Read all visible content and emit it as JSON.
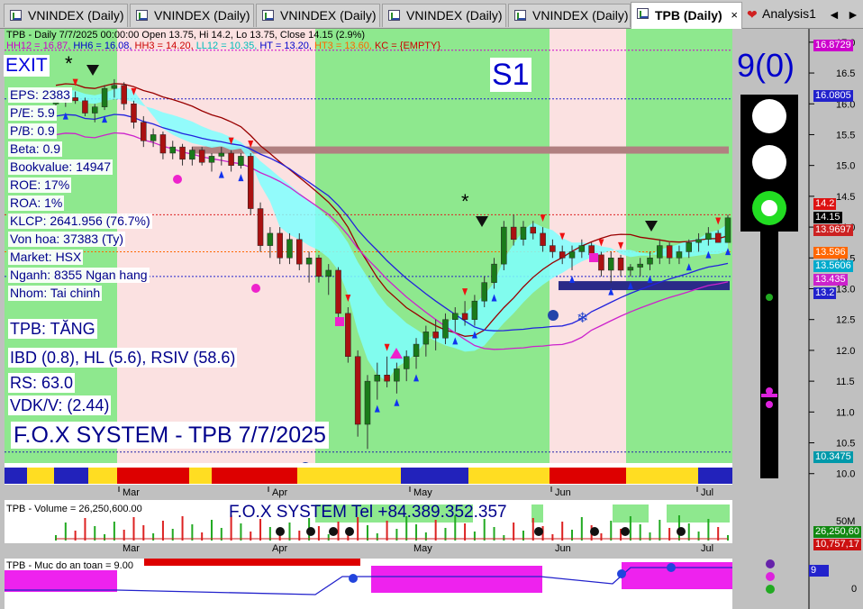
{
  "tabs": [
    {
      "label": "VNINDEX (Daily)",
      "active": false
    },
    {
      "label": "VNINDEX (Daily)",
      "active": false
    },
    {
      "label": "VNINDEX (Daily)",
      "active": false
    },
    {
      "label": "VNINDEX (Daily)",
      "active": false
    },
    {
      "label": "VNINDEX (Daily)",
      "active": false
    },
    {
      "label": "TPB (Daily)",
      "active": true,
      "close": "×"
    },
    {
      "label": "Analysis1",
      "active": false
    }
  ],
  "nav": {
    "left": "◄",
    "right": "►"
  },
  "header": {
    "line1": "TPB - Daily 7/7/2025 00:00:00 Open 13.75, Hi 14.2, Lo 13.75, Close 14.15 (2.9%)",
    "line2": [
      {
        "text": "HH12 = 16.87,",
        "color": "#cc00cc"
      },
      {
        "text": "HH6 = 16.08,",
        "color": "#0000cc"
      },
      {
        "text": "HH3 = 14.20,",
        "color": "#cc0000"
      },
      {
        "text": "LL12 = 10.35,",
        "color": "#00cccc"
      },
      {
        "text": "HT = 13.20,",
        "color": "#0000cc"
      },
      {
        "text": "HT3 = 13.60,",
        "color": "#ff6600"
      },
      {
        "text": "KC = {EMPTY}",
        "color": "#cc0000"
      }
    ]
  },
  "signals": {
    "exit": "EXIT",
    "s1": "S1",
    "nine_zero": "9(0)"
  },
  "fundamentals": [
    "EPS: 2383",
    "P/E: 5.9",
    "P/B: 0.9",
    "Beta: 0.9",
    "Bookvalue: 14947",
    "ROE: 17%",
    "ROA: 1%",
    "KLCP: 2641.956 (76.7%)",
    "Von hoa: 37383 (Ty)",
    "Market: HSX",
    "Nganh: 8355 Ngan hang",
    "Nhom: Tai chinh"
  ],
  "analysis": [
    "TPB: TĂNG",
    "IBD (0.8), HL (5.6), RSIV (58.6)",
    "RS: 63.0",
    "VDK/V:  (2.44)"
  ],
  "fox_title": "F.O.X SYSTEM - TPB 7/7/2025",
  "volume": {
    "title": "TPB - Volume = 26,250,600.00",
    "brand": "F.O.X SYSTEM Tel +84.389.352.357",
    "scale": "50M",
    "last": "26,250,60",
    "ma": "10,757,17"
  },
  "safety": {
    "title": "TPB - Muc do an toan = 9.00",
    "value_tag": "9",
    "zero": "0"
  },
  "months": [
    "Mar",
    "Apr",
    "May",
    "Jun",
    "Jul"
  ],
  "y_ticks": [
    "17.0",
    "16.5",
    "16.0",
    "15.5",
    "15.0",
    "14.5",
    "14.0",
    "13.5",
    "13.0",
    "12.5",
    "12.0",
    "11.5",
    "11.0",
    "10.5",
    "10.0"
  ],
  "price_tags": [
    {
      "text": "16.8729",
      "color": "#cc00cc"
    },
    {
      "text": "16.0805",
      "color": "#2222cc"
    },
    {
      "text": "14.2",
      "color": "#dd1111"
    },
    {
      "text": "14.15",
      "color": "#000000"
    },
    {
      "text": "13.9697",
      "color": "#cc2222"
    },
    {
      "text": "13.596",
      "color": "#ff6600"
    },
    {
      "text": "13.5606",
      "color": "#00aacc"
    },
    {
      "text": "13.435",
      "color": "#cc22cc"
    },
    {
      "text": "13.2",
      "color": "#2222cc"
    },
    {
      "text": "10.3475",
      "color": "#0099aa"
    }
  ],
  "chart_data": {
    "type": "candlestick",
    "ylim": [
      9.85,
      17.1
    ],
    "candles": [
      [
        16.0,
        16.1,
        15.9,
        16.05
      ],
      [
        16.05,
        16.15,
        15.95,
        16.1
      ],
      [
        16.1,
        16.2,
        16.0,
        16.05
      ],
      [
        16.05,
        16.1,
        15.8,
        15.85
      ],
      [
        15.85,
        16.0,
        15.7,
        15.95
      ],
      [
        15.95,
        16.3,
        15.9,
        16.25
      ],
      [
        16.25,
        16.4,
        16.1,
        16.3
      ],
      [
        16.3,
        16.35,
        15.9,
        16.0
      ],
      [
        16.0,
        16.05,
        15.6,
        15.7
      ],
      [
        15.7,
        15.8,
        15.3,
        15.4
      ],
      [
        15.4,
        15.6,
        15.3,
        15.5
      ],
      [
        15.5,
        15.55,
        15.1,
        15.2
      ],
      [
        15.2,
        15.4,
        15.1,
        15.3
      ],
      [
        15.3,
        15.35,
        15.0,
        15.1
      ],
      [
        15.1,
        15.3,
        15.0,
        15.25
      ],
      [
        15.25,
        15.3,
        15.0,
        15.05
      ],
      [
        15.05,
        15.2,
        14.9,
        15.15
      ],
      [
        15.15,
        15.3,
        15.0,
        15.2
      ],
      [
        15.2,
        15.25,
        14.9,
        15.0
      ],
      [
        15.0,
        15.2,
        14.95,
        15.15
      ],
      [
        15.15,
        15.2,
        14.2,
        14.3
      ],
      [
        14.3,
        14.4,
        13.6,
        13.7
      ],
      [
        13.7,
        14.0,
        13.5,
        13.9
      ],
      [
        13.9,
        14.0,
        13.4,
        13.5
      ],
      [
        13.5,
        13.9,
        13.4,
        13.8
      ],
      [
        13.8,
        13.9,
        13.3,
        13.4
      ],
      [
        13.4,
        13.6,
        13.1,
        13.5
      ],
      [
        13.5,
        13.55,
        13.1,
        13.2
      ],
      [
        13.2,
        13.4,
        12.9,
        13.3
      ],
      [
        13.3,
        13.35,
        12.5,
        12.6
      ],
      [
        12.6,
        12.7,
        11.8,
        11.9
      ],
      [
        11.9,
        12.0,
        10.6,
        10.8
      ],
      [
        10.8,
        11.6,
        10.4,
        11.5
      ],
      [
        11.5,
        11.8,
        11.2,
        11.6
      ],
      [
        11.6,
        11.9,
        11.4,
        11.5
      ],
      [
        11.5,
        11.8,
        11.3,
        11.7
      ],
      [
        11.7,
        12.0,
        11.5,
        11.9
      ],
      [
        11.9,
        12.2,
        11.7,
        12.1
      ],
      [
        12.1,
        12.4,
        11.9,
        12.3
      ],
      [
        12.3,
        12.5,
        12.0,
        12.2
      ],
      [
        12.2,
        12.6,
        12.1,
        12.5
      ],
      [
        12.5,
        12.7,
        12.3,
        12.6
      ],
      [
        12.6,
        12.8,
        12.4,
        12.5
      ],
      [
        12.5,
        12.9,
        12.4,
        12.8
      ],
      [
        12.8,
        13.2,
        12.7,
        13.1
      ],
      [
        13.1,
        13.5,
        13.0,
        13.4
      ],
      [
        13.4,
        14.1,
        13.3,
        14.0
      ],
      [
        14.0,
        14.2,
        13.7,
        13.8
      ],
      [
        13.8,
        14.1,
        13.7,
        14.0
      ],
      [
        14.0,
        14.1,
        13.8,
        13.9
      ],
      [
        13.9,
        14.0,
        13.6,
        13.7
      ],
      [
        13.7,
        13.8,
        13.5,
        13.6
      ],
      [
        13.6,
        13.7,
        13.4,
        13.5
      ],
      [
        13.5,
        13.7,
        13.3,
        13.6
      ],
      [
        13.6,
        13.8,
        13.5,
        13.7
      ],
      [
        13.7,
        13.75,
        13.5,
        13.55
      ],
      [
        13.55,
        13.6,
        13.2,
        13.3
      ],
      [
        13.3,
        13.6,
        13.1,
        13.5
      ],
      [
        13.5,
        13.55,
        13.2,
        13.3
      ],
      [
        13.3,
        13.4,
        13.2,
        13.35
      ],
      [
        13.35,
        13.5,
        13.2,
        13.4
      ],
      [
        13.4,
        13.6,
        13.3,
        13.5
      ],
      [
        13.5,
        13.8,
        13.4,
        13.7
      ],
      [
        13.7,
        13.75,
        13.4,
        13.5
      ],
      [
        13.5,
        13.7,
        13.4,
        13.6
      ],
      [
        13.6,
        13.8,
        13.5,
        13.75
      ],
      [
        13.75,
        13.9,
        13.6,
        13.8
      ],
      [
        13.8,
        14.0,
        13.7,
        13.9
      ],
      [
        13.9,
        13.95,
        13.75,
        13.75
      ],
      [
        13.75,
        14.2,
        13.75,
        14.15
      ]
    ]
  },
  "colors": {
    "green_zone": "#8ee88e",
    "pink_zone": "#fbe1e1",
    "up": "#1a7a1a",
    "down": "#b01010",
    "band": "#7fffff",
    "volume_bg": "#ffffff"
  }
}
